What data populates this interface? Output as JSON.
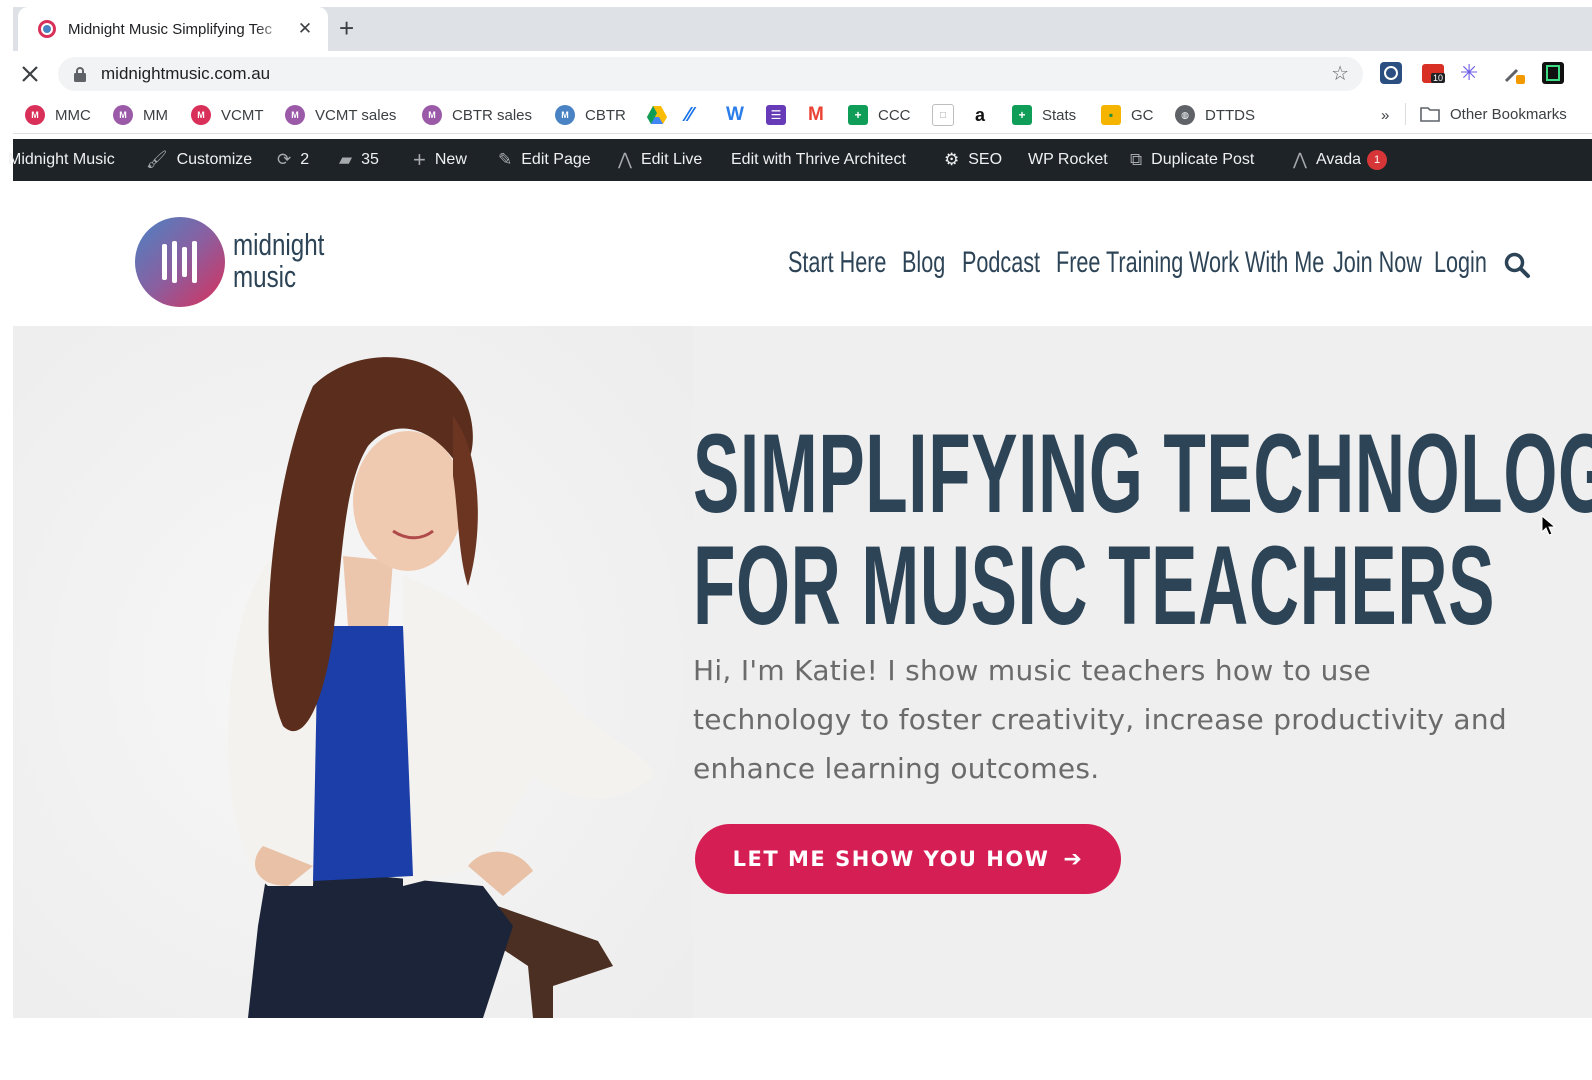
{
  "browser": {
    "tab_title": "Midnight Music Simplifying Tec",
    "url": "midnightmusic.com.au",
    "extension_badge": "10"
  },
  "bookmarks": [
    {
      "label": "MMC",
      "icon": "midnight-music-icon",
      "color": "#d9305a"
    },
    {
      "label": "MM",
      "icon": "midnight-music-icon",
      "color": "#9b5aa8"
    },
    {
      "label": "VCMT",
      "icon": "midnight-music-icon",
      "color": "#d9305a"
    },
    {
      "label": "VCMT sales",
      "icon": "midnight-music-icon",
      "color": "#9b5aa8"
    },
    {
      "label": "CBTR sales",
      "icon": "midnight-music-icon",
      "color": "#9b5aa8"
    },
    {
      "label": "CBTR",
      "icon": "midnight-music-icon",
      "color": "#4a83c4"
    },
    {
      "label": "CCC",
      "icon": "sheets-icon",
      "color": "#0f9d58"
    },
    {
      "label": "a",
      "icon": "amazon-icon"
    },
    {
      "label": "Stats",
      "icon": "sheets-icon",
      "color": "#0f9d58"
    },
    {
      "label": "GC",
      "icon": "classroom-icon",
      "color": "#f4b400"
    },
    {
      "label": "DTTDS",
      "icon": "globe-icon"
    },
    {
      "label": "»",
      "icon": "overflow-chevron"
    },
    {
      "label": "Other Bookmarks",
      "icon": "folder-icon"
    }
  ],
  "admin_bar": {
    "site": "Midnight Music",
    "customize": "Customize",
    "updates": "2",
    "comments": "35",
    "new": "New",
    "edit_page": "Edit Page",
    "edit_live": "Edit Live",
    "thrive": "Edit with Thrive Architect",
    "seo": "SEO",
    "wp_rocket": "WP Rocket",
    "duplicate": "Duplicate Post",
    "avada": "Avada",
    "avada_badge": "1"
  },
  "site": {
    "logo_line1": "midnight",
    "logo_line2": "music",
    "nav": [
      "Start Here",
      "Blog",
      "Podcast",
      "Free Training",
      "Work With Me",
      "Join Now",
      "Login"
    ]
  },
  "hero": {
    "headline_line1": "SIMPLIFYING TECHNOLOGY",
    "headline_line2": "FOR MUSIC TEACHERS",
    "intro": "Hi, I'm Katie! I show music teachers how to use technology to foster creativity, increase productivity and enhance learning outcomes.",
    "cta": "LET ME SHOW YOU HOW",
    "cta_color": "#d51f54",
    "heading_color": "#2d4457"
  }
}
